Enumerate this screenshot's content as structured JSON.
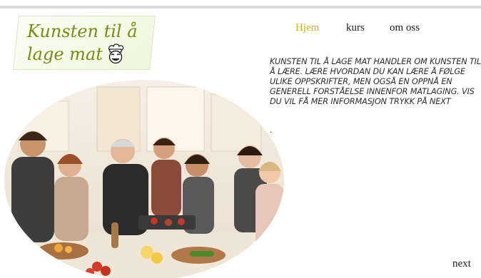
{
  "logo": {
    "line1": "Kunsten til å",
    "line2": "lage mat",
    "icon": "chef-face-icon"
  },
  "nav": {
    "items": [
      {
        "label": "Hjem",
        "active": true
      },
      {
        "label": "kurs",
        "active": false
      },
      {
        "label": "om oss",
        "active": false
      }
    ]
  },
  "intro": {
    "text": "KUNSTEN TIL Å LAGE MAT HANDLER OM KUNSTEN TIL Å LÆRE. LÆRE HVORDAN DU KAN LÆRE Å FØLGE ULIKE OPPSKRIFTER, MEN OGSÅ EN OPPNÅ EN GENERELL FORSTÅELSE INNENFOR MATLAGING. VIS DU VIL FÅ MER INFORMASJON TRYKK PÅ NEXT",
    "trailing": "."
  },
  "hero_image": {
    "subject": "group-cooking-photo"
  },
  "footer": {
    "next_label": "next"
  },
  "colors": {
    "accent_active": "#c9b21a",
    "logo_text": "#7a8a14",
    "body_text": "#2b2b2b"
  }
}
